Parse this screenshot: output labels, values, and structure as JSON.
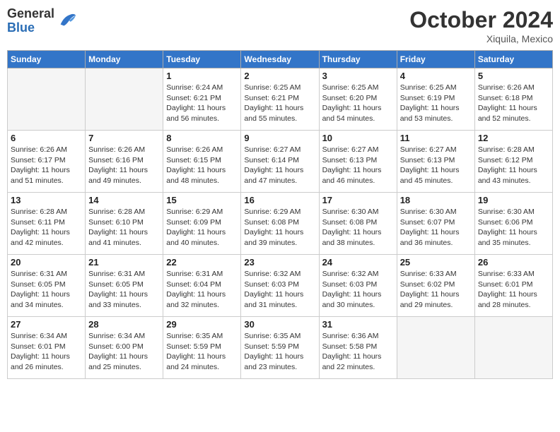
{
  "header": {
    "logo": {
      "general": "General",
      "blue": "Blue"
    },
    "title": "October 2024",
    "location": "Xiquila, Mexico"
  },
  "calendar": {
    "days_of_week": [
      "Sunday",
      "Monday",
      "Tuesday",
      "Wednesday",
      "Thursday",
      "Friday",
      "Saturday"
    ],
    "weeks": [
      [
        {
          "day": "",
          "empty": true
        },
        {
          "day": "",
          "empty": true
        },
        {
          "day": "1",
          "sunrise": "6:24 AM",
          "sunset": "6:21 PM",
          "daylight": "11 hours and 56 minutes."
        },
        {
          "day": "2",
          "sunrise": "6:25 AM",
          "sunset": "6:21 PM",
          "daylight": "11 hours and 55 minutes."
        },
        {
          "day": "3",
          "sunrise": "6:25 AM",
          "sunset": "6:20 PM",
          "daylight": "11 hours and 54 minutes."
        },
        {
          "day": "4",
          "sunrise": "6:25 AM",
          "sunset": "6:19 PM",
          "daylight": "11 hours and 53 minutes."
        },
        {
          "day": "5",
          "sunrise": "6:26 AM",
          "sunset": "6:18 PM",
          "daylight": "11 hours and 52 minutes."
        }
      ],
      [
        {
          "day": "6",
          "sunrise": "6:26 AM",
          "sunset": "6:17 PM",
          "daylight": "11 hours and 51 minutes."
        },
        {
          "day": "7",
          "sunrise": "6:26 AM",
          "sunset": "6:16 PM",
          "daylight": "11 hours and 49 minutes."
        },
        {
          "day": "8",
          "sunrise": "6:26 AM",
          "sunset": "6:15 PM",
          "daylight": "11 hours and 48 minutes."
        },
        {
          "day": "9",
          "sunrise": "6:27 AM",
          "sunset": "6:14 PM",
          "daylight": "11 hours and 47 minutes."
        },
        {
          "day": "10",
          "sunrise": "6:27 AM",
          "sunset": "6:13 PM",
          "daylight": "11 hours and 46 minutes."
        },
        {
          "day": "11",
          "sunrise": "6:27 AM",
          "sunset": "6:13 PM",
          "daylight": "11 hours and 45 minutes."
        },
        {
          "day": "12",
          "sunrise": "6:28 AM",
          "sunset": "6:12 PM",
          "daylight": "11 hours and 43 minutes."
        }
      ],
      [
        {
          "day": "13",
          "sunrise": "6:28 AM",
          "sunset": "6:11 PM",
          "daylight": "11 hours and 42 minutes."
        },
        {
          "day": "14",
          "sunrise": "6:28 AM",
          "sunset": "6:10 PM",
          "daylight": "11 hours and 41 minutes."
        },
        {
          "day": "15",
          "sunrise": "6:29 AM",
          "sunset": "6:09 PM",
          "daylight": "11 hours and 40 minutes."
        },
        {
          "day": "16",
          "sunrise": "6:29 AM",
          "sunset": "6:08 PM",
          "daylight": "11 hours and 39 minutes."
        },
        {
          "day": "17",
          "sunrise": "6:30 AM",
          "sunset": "6:08 PM",
          "daylight": "11 hours and 38 minutes."
        },
        {
          "day": "18",
          "sunrise": "6:30 AM",
          "sunset": "6:07 PM",
          "daylight": "11 hours and 36 minutes."
        },
        {
          "day": "19",
          "sunrise": "6:30 AM",
          "sunset": "6:06 PM",
          "daylight": "11 hours and 35 minutes."
        }
      ],
      [
        {
          "day": "20",
          "sunrise": "6:31 AM",
          "sunset": "6:05 PM",
          "daylight": "11 hours and 34 minutes."
        },
        {
          "day": "21",
          "sunrise": "6:31 AM",
          "sunset": "6:05 PM",
          "daylight": "11 hours and 33 minutes."
        },
        {
          "day": "22",
          "sunrise": "6:31 AM",
          "sunset": "6:04 PM",
          "daylight": "11 hours and 32 minutes."
        },
        {
          "day": "23",
          "sunrise": "6:32 AM",
          "sunset": "6:03 PM",
          "daylight": "11 hours and 31 minutes."
        },
        {
          "day": "24",
          "sunrise": "6:32 AM",
          "sunset": "6:03 PM",
          "daylight": "11 hours and 30 minutes."
        },
        {
          "day": "25",
          "sunrise": "6:33 AM",
          "sunset": "6:02 PM",
          "daylight": "11 hours and 29 minutes."
        },
        {
          "day": "26",
          "sunrise": "6:33 AM",
          "sunset": "6:01 PM",
          "daylight": "11 hours and 28 minutes."
        }
      ],
      [
        {
          "day": "27",
          "sunrise": "6:34 AM",
          "sunset": "6:01 PM",
          "daylight": "11 hours and 26 minutes."
        },
        {
          "day": "28",
          "sunrise": "6:34 AM",
          "sunset": "6:00 PM",
          "daylight": "11 hours and 25 minutes."
        },
        {
          "day": "29",
          "sunrise": "6:35 AM",
          "sunset": "5:59 PM",
          "daylight": "11 hours and 24 minutes."
        },
        {
          "day": "30",
          "sunrise": "6:35 AM",
          "sunset": "5:59 PM",
          "daylight": "11 hours and 23 minutes."
        },
        {
          "day": "31",
          "sunrise": "6:36 AM",
          "sunset": "5:58 PM",
          "daylight": "11 hours and 22 minutes."
        },
        {
          "day": "",
          "empty": true
        },
        {
          "day": "",
          "empty": true
        }
      ]
    ],
    "labels": {
      "sunrise": "Sunrise:",
      "sunset": "Sunset:",
      "daylight": "Daylight:"
    }
  }
}
